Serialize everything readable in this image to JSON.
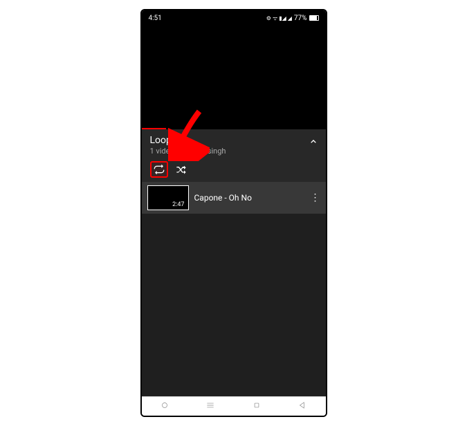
{
  "status": {
    "time": "4:51",
    "battery": "77%"
  },
  "playlist": {
    "title": "Loop",
    "meta": "1 video • Bhavna singh"
  },
  "item": {
    "title": "Capone - Oh No",
    "duration": "2:47"
  }
}
